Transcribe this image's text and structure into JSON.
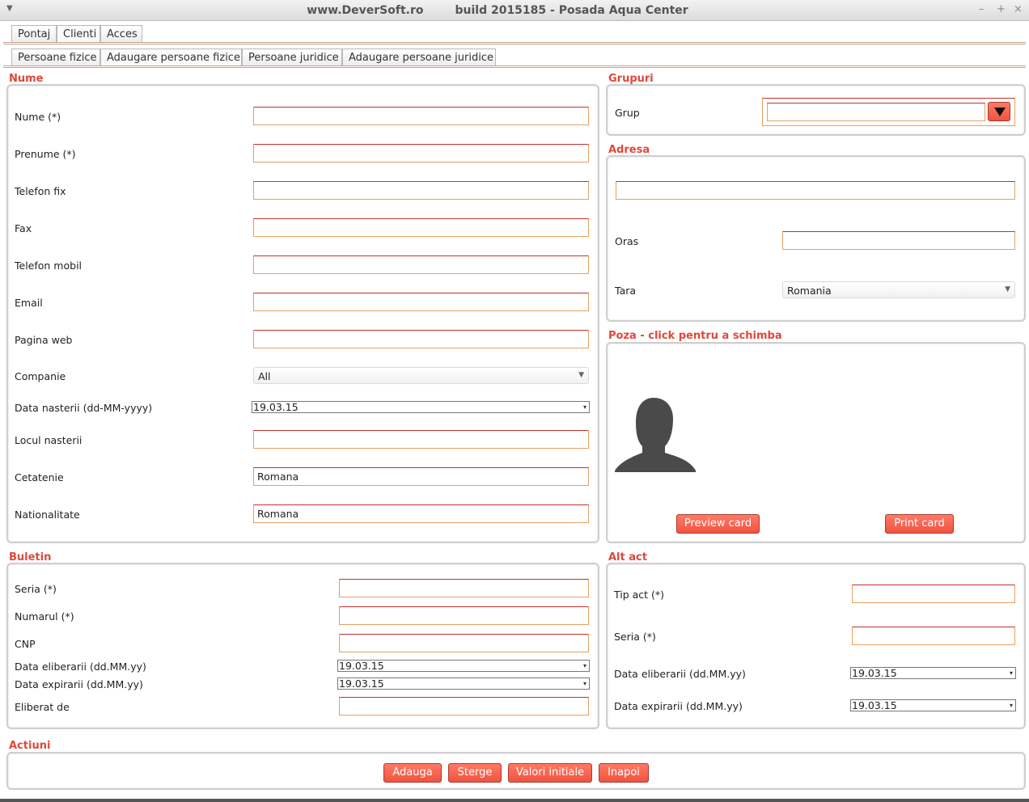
{
  "window": {
    "title": "www.DeverSoft.ro        build 2015185 - Posada Aqua Center",
    "controls": {
      "minimize": "–",
      "maximize": "+",
      "close": "×"
    }
  },
  "main_tabs": [
    {
      "label": "Pontaj"
    },
    {
      "label": "Clienti"
    },
    {
      "label": "Acces"
    }
  ],
  "sub_tabs": [
    {
      "label": "Persoane fizice"
    },
    {
      "label": "Adaugare persoane fizice"
    },
    {
      "label": "Persoane juridice"
    },
    {
      "label": "Adaugare persoane juridice"
    }
  ],
  "nume": {
    "title": "Nume",
    "nume_label": "Nume (*)",
    "nume_value": "",
    "prenume_label": "Prenume (*)",
    "prenume_value": "",
    "telefon_fix_label": "Telefon fix",
    "telefon_fix_value": "",
    "fax_label": "Fax",
    "fax_value": "",
    "telefon_mobil_label": "Telefon mobil",
    "telefon_mobil_value": "",
    "email_label": "Email",
    "email_value": "",
    "pagina_web_label": "Pagina web",
    "pagina_web_value": "",
    "companie_label": "Companie",
    "companie_value": "All",
    "data_nasterii_label": "Data nasterii (dd-MM-yyyy)",
    "data_nasterii_value": "19.03.15",
    "locul_nasterii_label": "Locul nasterii",
    "locul_nasterii_value": "",
    "cetatenie_label": "Cetatenie",
    "cetatenie_value": "Romana",
    "nationalitate_label": "Nationalitate",
    "nationalitate_value": "Romana"
  },
  "grupuri": {
    "title": "Grupuri",
    "grup_label": "Grup",
    "grup_value": ""
  },
  "adresa": {
    "title": "Adresa",
    "adresa_value": "",
    "oras_label": "Oras",
    "oras_value": "",
    "tara_label": "Tara",
    "tara_value": "Romania"
  },
  "poza": {
    "title": "Poza - click pentru a schimba",
    "preview_button": "Preview card",
    "print_button": "Print card"
  },
  "buletin": {
    "title": "Buletin",
    "seria_label": "Seria (*)",
    "seria_value": "",
    "numarul_label": "Numarul (*)",
    "numarul_value": "",
    "cnp_label": "CNP",
    "cnp_value": "",
    "data_eliberarii_label": "Data eliberarii (dd.MM.yy)",
    "data_eliberarii_value": "19.03.15",
    "data_expirarii_label": "Data expirarii (dd.MM.yy)",
    "data_expirarii_value": "19.03.15",
    "eliberat_de_label": "Eliberat de",
    "eliberat_de_value": ""
  },
  "alt_act": {
    "title": "Alt act",
    "tip_act_label": "Tip act (*)",
    "tip_act_value": "",
    "seria_label": "Seria (*)",
    "seria_value": "",
    "data_eliberarii_label": "Data eliberarii (dd.MM.yy)",
    "data_eliberarii_value": "19.03.15",
    "data_expirarii_label": "Data expirarii (dd.MM.yy)",
    "data_expirarii_value": "19.03.15"
  },
  "actiuni": {
    "title": "Actiuni",
    "adauga": "Adauga",
    "sterge": "Sterge",
    "valori_initiale": "Valori initiale",
    "inapoi": "Inapoi"
  },
  "colors": {
    "accent": "#f0533f",
    "section_title": "#e0483a",
    "field_border_top": "#c43030",
    "field_border": "#e8a060"
  },
  "icons": {
    "window_menu": "chevron-down-icon",
    "avatar": "person-silhouette-icon",
    "dropdown": "triangle-down-icon"
  }
}
